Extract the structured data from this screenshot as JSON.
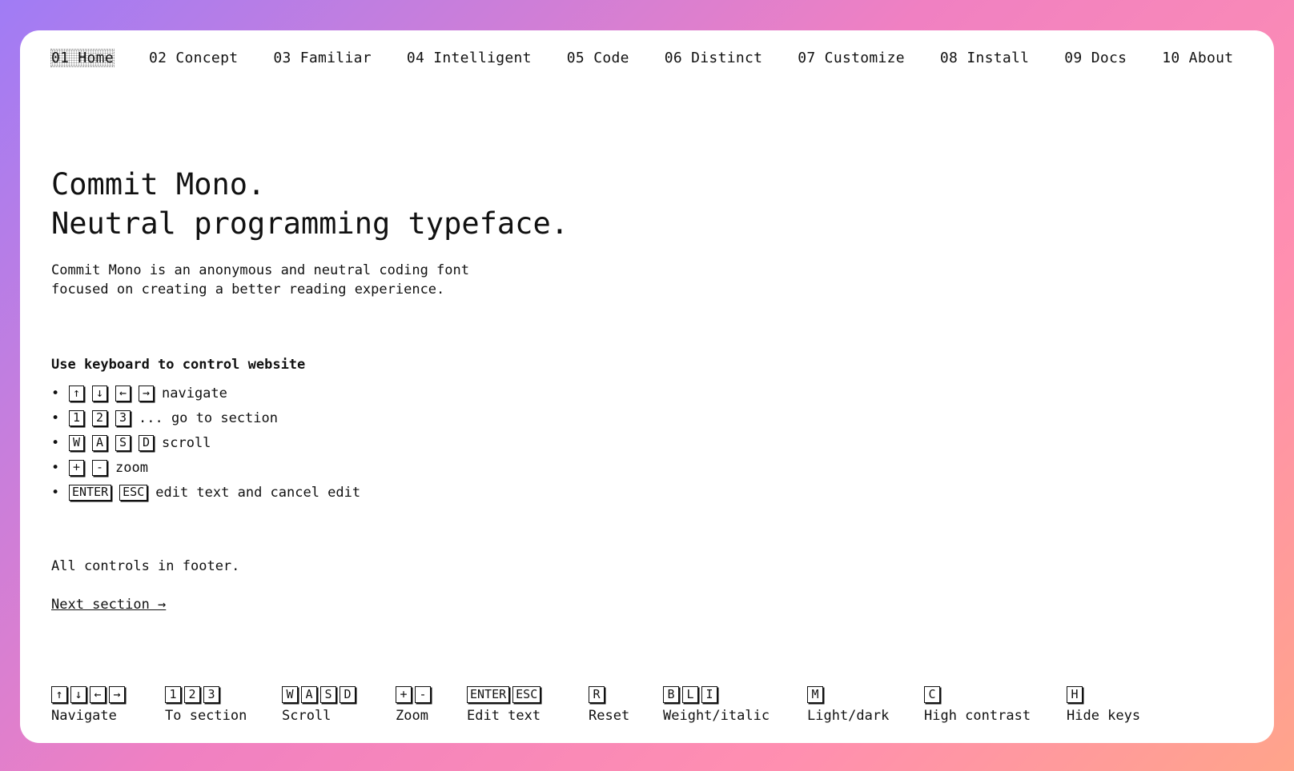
{
  "nav": {
    "items": [
      "01 Home",
      "02 Concept",
      "03 Familiar",
      "04 Intelligent",
      "05 Code",
      "06 Distinct",
      "07 Customize",
      "08 Install",
      "09 Docs",
      "10 About"
    ],
    "active_index": 0
  },
  "hero": {
    "line1": "Commit Mono.",
    "line2": "Neutral programming typeface."
  },
  "description": {
    "line1": "Commit Mono is an anonymous and neutral coding font",
    "line2": "focused on creating a better reading experience."
  },
  "keyboard": {
    "title": "Use keyboard to control website",
    "rows": [
      {
        "keys": [
          "↑",
          "↓",
          "←",
          "→"
        ],
        "text": "navigate"
      },
      {
        "keys": [
          "1",
          "2",
          "3"
        ],
        "text": "... go to section"
      },
      {
        "keys": [
          "W",
          "A",
          "S",
          "D"
        ],
        "text": "scroll"
      },
      {
        "keys": [
          "+",
          "-"
        ],
        "text": "zoom"
      },
      {
        "keys": [
          "ENTER",
          "ESC"
        ],
        "text": "edit text and cancel edit"
      }
    ]
  },
  "footnote": "All controls in footer.",
  "next_link": "Next section →",
  "footer": {
    "controls": [
      {
        "keys": [
          "↑",
          "↓",
          "←",
          "→"
        ],
        "label": "Navigate"
      },
      {
        "keys": [
          "1",
          "2",
          "3"
        ],
        "label": "To section"
      },
      {
        "keys": [
          "W",
          "A",
          "S",
          "D"
        ],
        "label": "Scroll"
      },
      {
        "keys": [
          "+",
          "-"
        ],
        "label": "Zoom"
      },
      {
        "keys": [
          "ENTER",
          "ESC"
        ],
        "label": "Edit text"
      },
      {
        "keys": [
          "R"
        ],
        "label": "Reset"
      },
      {
        "keys": [
          "B",
          "L",
          "I"
        ],
        "label": "Weight/italic"
      },
      {
        "keys": [
          "M"
        ],
        "label": "Light/dark"
      },
      {
        "keys": [
          "C"
        ],
        "label": "High contrast"
      },
      {
        "keys": [
          "H"
        ],
        "label": "Hide keys"
      }
    ]
  },
  "colors": {
    "gradient_start": "#a07cf5",
    "gradient_mid": "#f080c2",
    "gradient_end": "#ffa48a",
    "card_bg": "#ffffff",
    "text": "#111111"
  }
}
